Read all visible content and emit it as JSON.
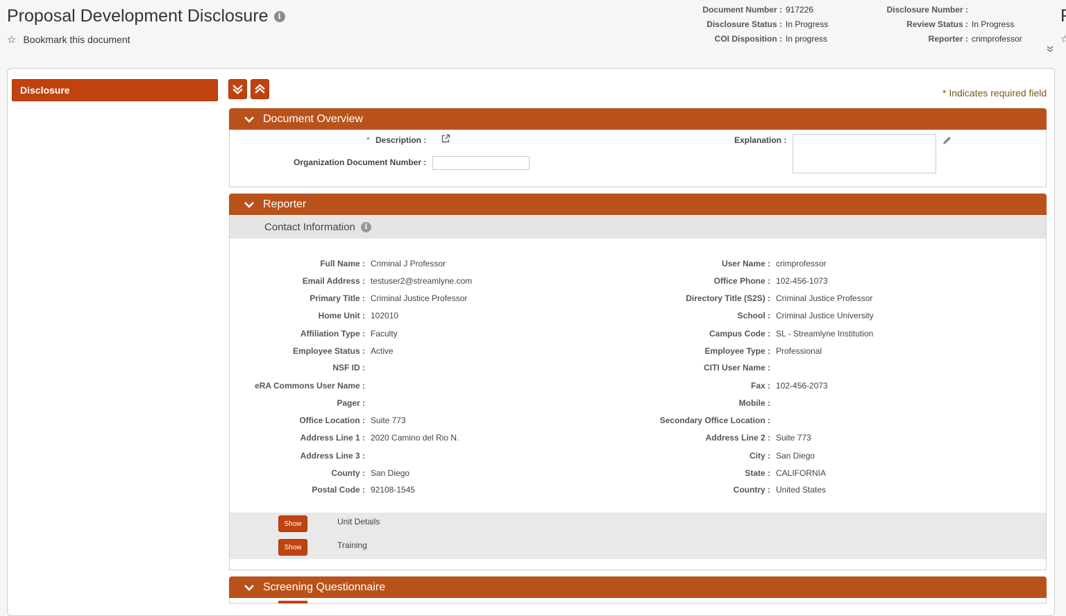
{
  "header": {
    "title": "Proposal Development Disclosure",
    "bookmark_label": "Bookmark this document",
    "meta_left": [
      {
        "label": "Document Number :",
        "value": "917226"
      },
      {
        "label": "Disclosure Status :",
        "value": "In Progress"
      },
      {
        "label": "COI Disposition :",
        "value": "In progress"
      }
    ],
    "meta_right": [
      {
        "label": "Disclosure Number :",
        "value": ""
      },
      {
        "label": "Review Status :",
        "value": "In Progress"
      },
      {
        "label": "Reporter :",
        "value": "crimprofessor"
      }
    ],
    "edge_letter": "F"
  },
  "nav": {
    "items": [
      {
        "label": "Disclosure"
      }
    ]
  },
  "required_note": "* Indicates required field",
  "document_overview": {
    "title": "Document Overview",
    "description_label": "Description :",
    "required_marker": "*",
    "org_doc_number_label": "Organization Document Number :",
    "org_doc_number_value": "",
    "explanation_label": "Explanation :"
  },
  "reporter": {
    "title": "Reporter",
    "contact_info_title": "Contact Information",
    "left_fields": [
      {
        "label": "Full Name :",
        "value": "Criminal J Professor"
      },
      {
        "label": "Email Address :",
        "value": "testuser2@streamlyne.com"
      },
      {
        "label": "Primary Title :",
        "value": "Criminal Justice Professor"
      },
      {
        "label": "Home Unit :",
        "value": "102010"
      },
      {
        "label": "Affiliation Type :",
        "value": "Faculty"
      },
      {
        "label": "Employee Status :",
        "value": "Active"
      },
      {
        "label": "NSF ID :",
        "value": ""
      },
      {
        "label": "eRA Commons User Name :",
        "value": ""
      },
      {
        "label": "Pager :",
        "value": ""
      },
      {
        "label": "Office Location :",
        "value": "Suite 773"
      },
      {
        "label": "Address Line 1 :",
        "value": "2020 Camino del Rio N."
      },
      {
        "label": "Address Line 3 :",
        "value": ""
      },
      {
        "label": "County :",
        "value": "San Diego"
      },
      {
        "label": "Postal Code :",
        "value": "92108-1545"
      }
    ],
    "right_fields": [
      {
        "label": "User Name :",
        "value": "crimprofessor"
      },
      {
        "label": "Office Phone :",
        "value": "102-456-1073"
      },
      {
        "label": "Directory Title (S2S) :",
        "value": "Criminal Justice Professor"
      },
      {
        "label": "School :",
        "value": "Criminal Justice University"
      },
      {
        "label": "Campus Code :",
        "value": "SL - Streamlyne Institution"
      },
      {
        "label": "Employee Type :",
        "value": "Professional"
      },
      {
        "label": "CITI User Name :",
        "value": ""
      },
      {
        "label": "Fax :",
        "value": "102-456-2073"
      },
      {
        "label": "Mobile :",
        "value": ""
      },
      {
        "label": "Secondary Office Location :",
        "value": ""
      },
      {
        "label": "Address Line 2 :",
        "value": "Suite 773"
      },
      {
        "label": "City :",
        "value": "San Diego"
      },
      {
        "label": "State :",
        "value": "CALIFORNIA"
      },
      {
        "label": "Country :",
        "value": "United States"
      }
    ],
    "subsections": [
      {
        "button": "Show",
        "label": "Unit Details"
      },
      {
        "button": "Show",
        "label": "Training"
      }
    ]
  },
  "screening": {
    "title": "Screening Questionnaire"
  },
  "colors": {
    "accent": "#c0430f",
    "panel_header": "#b9521a"
  }
}
